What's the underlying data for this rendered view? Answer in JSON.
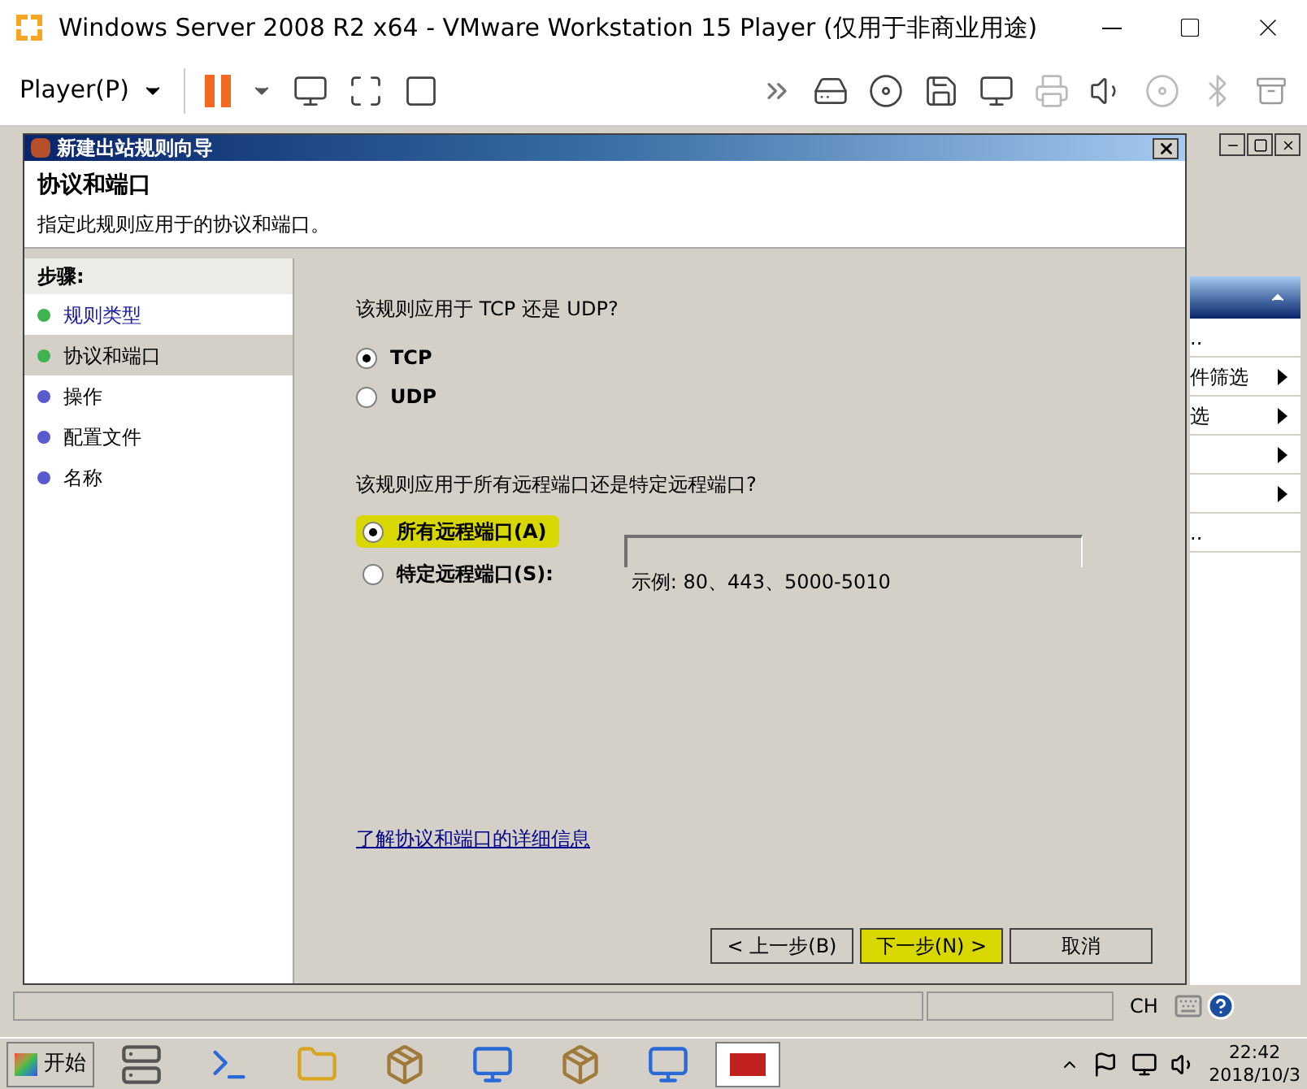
{
  "window": {
    "title": "Windows Server 2008 R2 x64 - VMware Workstation 15 Player (仅用于非商业用途)"
  },
  "toolbar": {
    "player_menu": "Player(P)"
  },
  "wizard": {
    "title": "新建出站规则向导",
    "heading": "协议和端口",
    "subtitle": "指定此规则应用于的协议和端口。",
    "steps_heading": "步骤:",
    "steps": [
      {
        "label": "规则类型",
        "selected": false,
        "done": true,
        "link": true
      },
      {
        "label": "协议和端口",
        "selected": true,
        "done": true,
        "link": false
      },
      {
        "label": "操作",
        "selected": false,
        "done": false,
        "link": false
      },
      {
        "label": "配置文件",
        "selected": false,
        "done": false,
        "link": false
      },
      {
        "label": "名称",
        "selected": false,
        "done": false,
        "link": false
      }
    ],
    "protocol_question": "该规则应用于 TCP 还是 UDP?",
    "protocols": [
      {
        "label": "TCP",
        "selected": true
      },
      {
        "label": "UDP",
        "selected": false
      }
    ],
    "port_question": "该规则应用于所有远程端口还是特定远程端口?",
    "port_options": [
      {
        "label": "所有远程端口(A)",
        "selected": true,
        "highlighted": true
      },
      {
        "label": "特定远程端口(S):",
        "selected": false,
        "highlighted": false
      }
    ],
    "example": "示例: 80、443、5000-5010",
    "help_link": "了解协议和端口的详细信息",
    "buttons": [
      {
        "label": "< 上一步(B)",
        "highlighted": false
      },
      {
        "label": "下一步(N) >",
        "highlighted": true
      },
      {
        "label": "取消",
        "highlighted": false
      }
    ]
  },
  "actions_panel": {
    "items": [
      {
        "label": "..",
        "arrow": false
      },
      {
        "label": "件筛选",
        "arrow": true
      },
      {
        "label": "选",
        "arrow": true
      },
      {
        "arrow": true
      },
      {
        "arrow": true
      },
      {
        "label": "..",
        "arrow": false
      }
    ]
  },
  "status_bar": {
    "language": "CH"
  },
  "taskbar": {
    "start": "开始",
    "time": "22:42",
    "date": "2018/10/3"
  }
}
